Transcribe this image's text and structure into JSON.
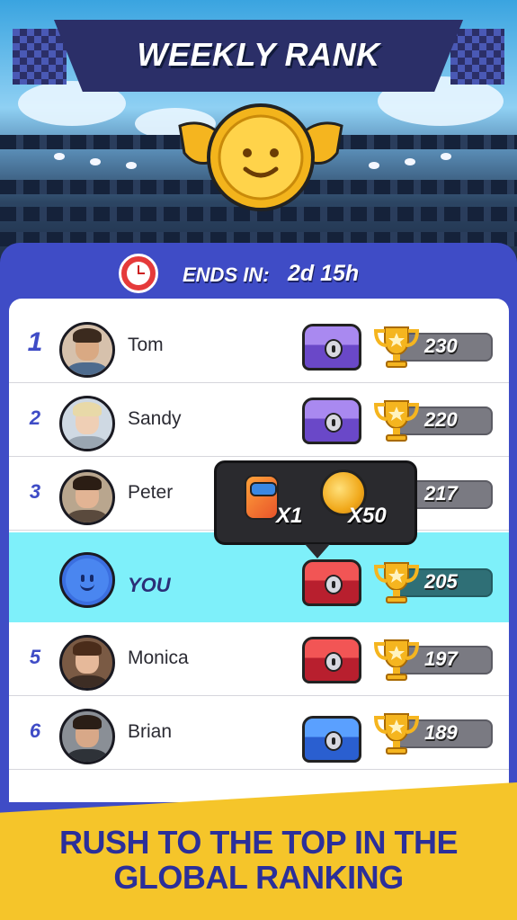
{
  "header": {
    "title": "WEEKLY RANK"
  },
  "timer": {
    "label": "ENDS IN:",
    "value": "2d 15h",
    "icon": "clock-icon"
  },
  "leaderboard": [
    {
      "rank": "1",
      "name": "Tom",
      "chest": "purple",
      "score": "230"
    },
    {
      "rank": "2",
      "name": "Sandy",
      "chest": "purple",
      "score": "220"
    },
    {
      "rank": "3",
      "name": "Peter",
      "chest": "",
      "score": "217"
    },
    {
      "rank": "",
      "name": "YOU",
      "chest": "red",
      "score": "205"
    },
    {
      "rank": "5",
      "name": "Monica",
      "chest": "red",
      "score": "197"
    },
    {
      "rank": "6",
      "name": "Brian",
      "chest": "blue",
      "score": "189"
    }
  ],
  "reward_popup": {
    "energy_qty": "X1",
    "coin_qty": "X50"
  },
  "cta": {
    "line1": "RUSH TO THE TOP IN THE",
    "line2": "GLOBAL RANKING"
  },
  "colors": {
    "panel": "#3f4cc6",
    "highlight_row": "#7ef0fa",
    "cta_background": "#f5c52a",
    "cta_text": "#2b2f9a"
  }
}
